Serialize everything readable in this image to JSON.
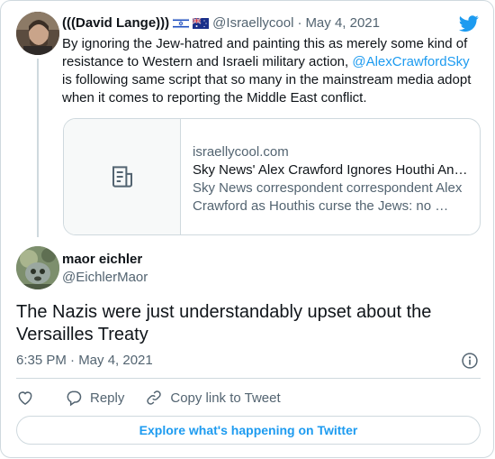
{
  "parent_tweet": {
    "name": "(((David Lange)))",
    "handle": "@Israellycool",
    "dot": "·",
    "date": "May 4, 2021",
    "text_before": "By ignoring the Jew-hatred and painting this as merely some kind of resistance to Western and Israeli military action, ",
    "mention": "@AlexCrawfordSky",
    "text_after": " is following same script that so many in the mainstream media adopt when it comes to reporting the Middle East conflict.",
    "flags": [
      "israel-flag",
      "australia-flag"
    ],
    "link_card": {
      "domain": "israellycool.com",
      "title": "Sky News' Alex Crawford Ignores Houthi An…",
      "description_line1": "Sky News correspondent correspondent Alex",
      "description_line2": "Crawford as Houthis curse the Jews: no …"
    }
  },
  "main_tweet": {
    "name": "maor eichler",
    "handle": "@EichlerMaor",
    "text": "The Nazis were just understandably upset about the Versailles Treaty",
    "timestamp": "6:35 PM · May 4, 2021"
  },
  "actions": {
    "reply": "Reply",
    "copy_link": "Copy link to Tweet"
  },
  "explore_button": "Explore what's happening on Twitter",
  "colors": {
    "accent": "#1d9bf0",
    "text": "#0f1419",
    "secondary": "#536471",
    "border": "#cfd9de"
  }
}
